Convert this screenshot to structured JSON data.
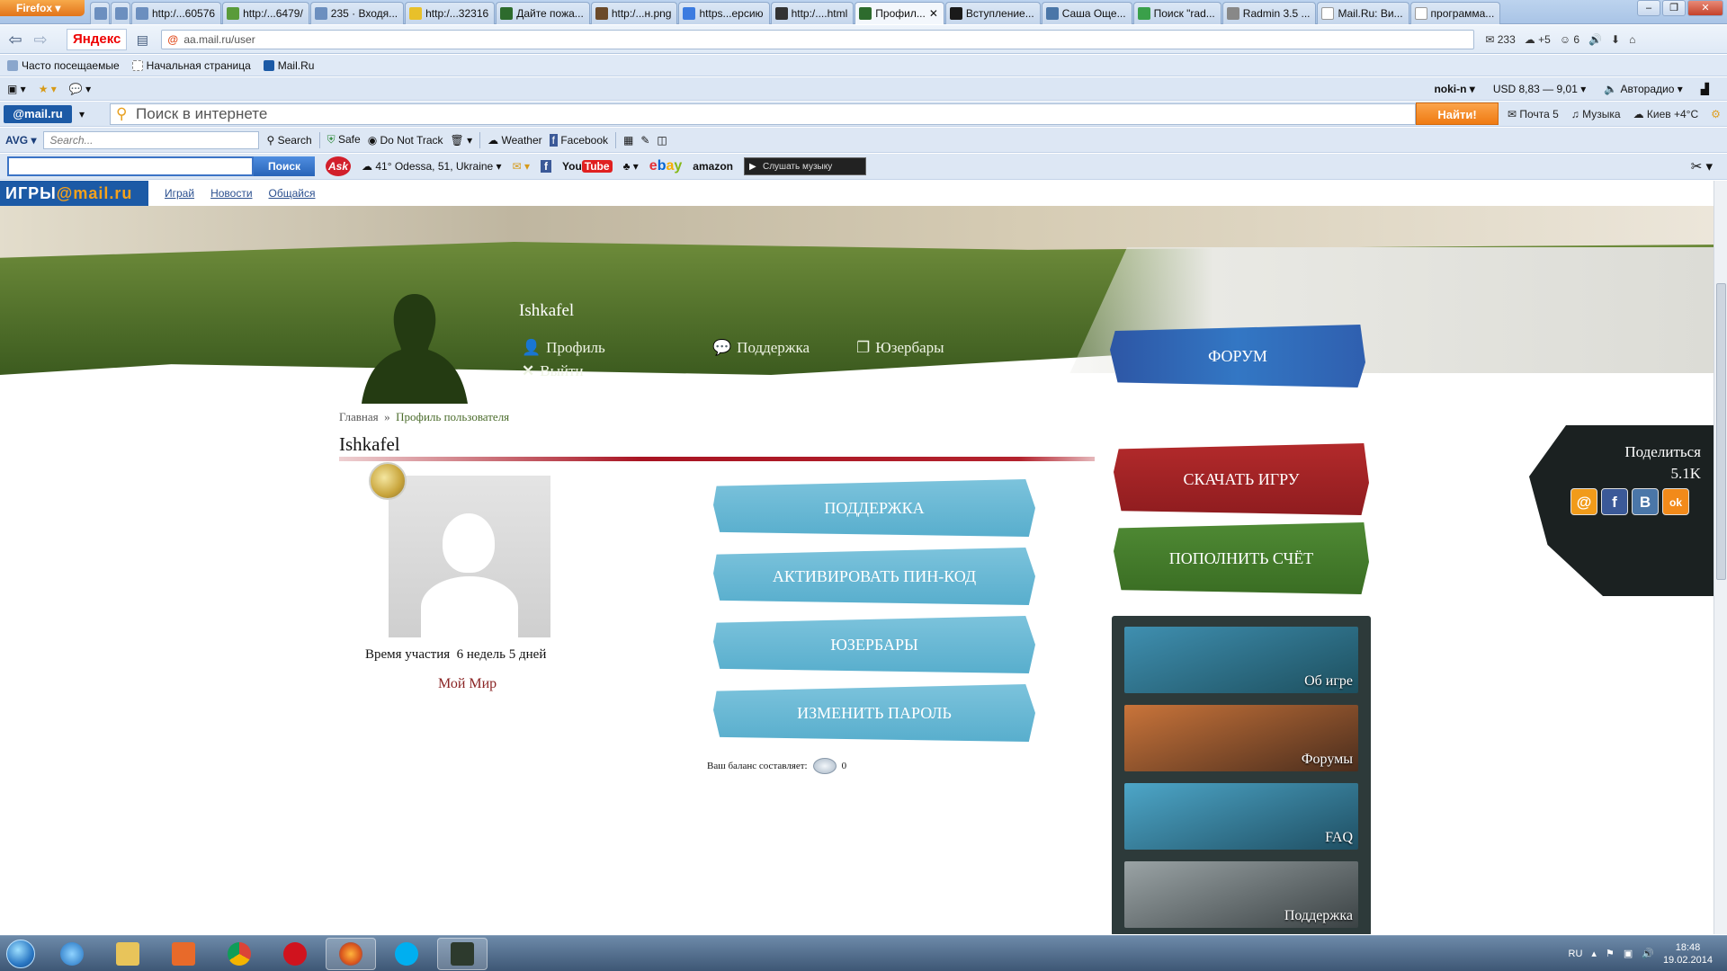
{
  "browser": {
    "menu_label": "Firefox",
    "tabs": [
      {
        "label": "",
        "active": false
      },
      {
        "label": "",
        "active": false
      },
      {
        "label": "http:/...60576",
        "active": false
      },
      {
        "label": "http:/...6479/",
        "active": false
      },
      {
        "label": "235 · Входя...",
        "active": false
      },
      {
        "label": "http:/...32316",
        "active": false
      },
      {
        "label": "Дайте пожа...",
        "active": false
      },
      {
        "label": "http:/...н.png",
        "active": false
      },
      {
        "label": "https...ерсию",
        "active": false
      },
      {
        "label": "http:/....html",
        "active": false
      },
      {
        "label": "Профил...",
        "active": true
      },
      {
        "label": "Вступление...",
        "active": false
      },
      {
        "label": "Саша Още...",
        "active": false
      },
      {
        "label": "Поиск \"rad...",
        "active": false
      },
      {
        "label": "Radmin 3.5 ...",
        "active": false
      },
      {
        "label": "Mail.Ru: Ви...",
        "active": false
      },
      {
        "label": "программа...",
        "active": false
      }
    ],
    "yandex_label": "Яндекс",
    "url": "aa.mail.ru/user",
    "nav_right": [
      "233",
      "+5",
      "6"
    ],
    "bookmarks": [
      "Часто посещаемые",
      "Начальная страница",
      "Mail.Ru"
    ],
    "toolbar3": {
      "user": "noki-n",
      "currency": "USD 8,83 — 9,01",
      "radio": "Авторадио"
    },
    "mail_logo": "@mail.ru",
    "mail_search_placeholder": "Поиск в интернете",
    "find_button": "Найти!",
    "mail_right": [
      "Почта 5",
      "Музыка",
      "Киев +4°C"
    ],
    "avg": {
      "logo": "AVG",
      "search_placeholder": "Search...",
      "search": "Search",
      "safe": "Safe",
      "dnt": "Do Not Track",
      "weather": "Weather",
      "facebook": "Facebook"
    },
    "ask": {
      "button": "Поиск",
      "logo": "Ask",
      "weather": "41° Odessa, 51, Ukraine",
      "youtube_a": "You",
      "youtube_b": "Tube",
      "ebay": [
        "e",
        "b",
        "a",
        "y"
      ],
      "amazon": "amazon",
      "player": "Слушать музыку"
    }
  },
  "site": {
    "logo_a": "ИГРЫ",
    "logo_b": "@mail.ru",
    "nav": [
      "Играй",
      "Новости",
      "Общайся"
    ],
    "header": {
      "username": "Ishkafel",
      "profile_link": "Профиль",
      "logout_link": "Выйти",
      "support_link": "Поддержка",
      "userbars_link": "Юзербары",
      "forum_button": "ФОРУМ"
    },
    "breadcrumb": {
      "home": "Главная",
      "sep": "»",
      "current": "Профиль пользователя"
    },
    "profile_name": "Ishkafel",
    "member_time_label": "Время участия",
    "member_time_value": "6 недель 5 дней",
    "my_world": "Мой Мир",
    "actions": [
      "ПОДДЕРЖКА",
      "АКТИВИРОВАТЬ ПИН-КОД",
      "ЮЗЕРБАРЫ",
      "ИЗМЕНИТЬ ПАРОЛЬ"
    ],
    "balance_label": "Ваш баланс составляет:",
    "balance_value": "0",
    "download_button": "СКАЧАТЬ ИГРУ",
    "topup_button": "ПОПОЛНИТЬ СЧЁТ",
    "side_cards": [
      {
        "label": "Об игре",
        "color_a": "#3f8fb0",
        "color_b": "#1d4f5e"
      },
      {
        "label": "Форумы",
        "color_a": "#c9743a",
        "color_b": "#4a2d1d"
      },
      {
        "label": "FAQ",
        "color_a": "#4da6c8",
        "color_b": "#1f4f63"
      },
      {
        "label": "Поддержка",
        "color_a": "#9aa3a5",
        "color_b": "#3b4244"
      }
    ],
    "share": {
      "title": "Поделиться",
      "count": "5.1K",
      "icons": [
        "@",
        "f",
        "B",
        "ok"
      ]
    }
  },
  "taskbar": {
    "lang": "RU",
    "time": "18:48",
    "date": "19.02.2014"
  }
}
